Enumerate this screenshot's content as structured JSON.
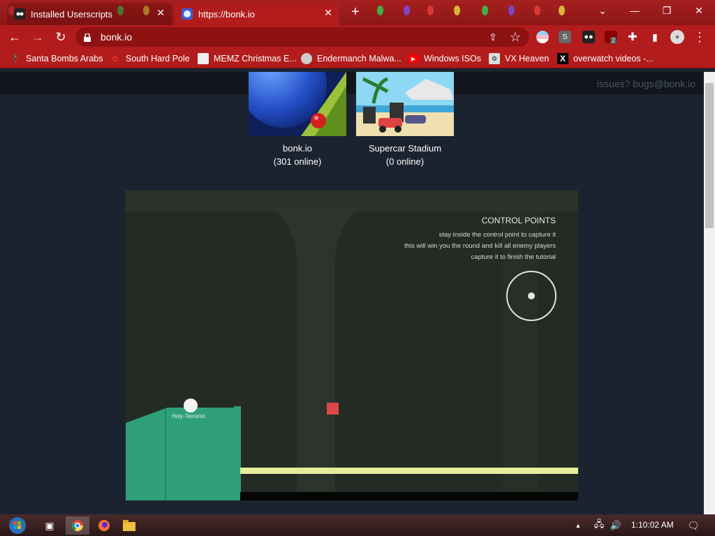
{
  "browser": {
    "tabs": [
      {
        "title": "Installed Userscripts",
        "active": false
      },
      {
        "title": "https://bonk.io",
        "active": true
      }
    ],
    "address": "bonk.io",
    "bookmarks": [
      {
        "label": "Santa Bombs Arabs",
        "icon": "santa-icon"
      },
      {
        "label": "South Hard Pole",
        "icon": "flower-icon"
      },
      {
        "label": "MEMZ Christmas E...",
        "icon": "page-icon"
      },
      {
        "label": "Endermanch Malwa...",
        "icon": "raccoon-icon"
      },
      {
        "label": "Windows ISOs",
        "icon": "youtube-icon"
      },
      {
        "label": "VX Heaven",
        "icon": "vx-icon"
      },
      {
        "label": "overwatch videos -...",
        "icon": "x-icon"
      }
    ],
    "extension_badge": "2"
  },
  "page": {
    "contact": "issues? bugs@bonk.io",
    "games": [
      {
        "name": "bonk.io",
        "online": "(301 online)"
      },
      {
        "name": "Supercar Stadium",
        "online": "(0 online)"
      }
    ],
    "tutorial": {
      "title": "CONTROL POINTS",
      "lines": [
        "stay inside the control point to capture it",
        "this will win you the round and kill all enemy players",
        "capture it to finish the tutorial"
      ],
      "player_name": "Holy-Terrorist"
    }
  },
  "taskbar": {
    "clock": "1:10:02 AM"
  }
}
